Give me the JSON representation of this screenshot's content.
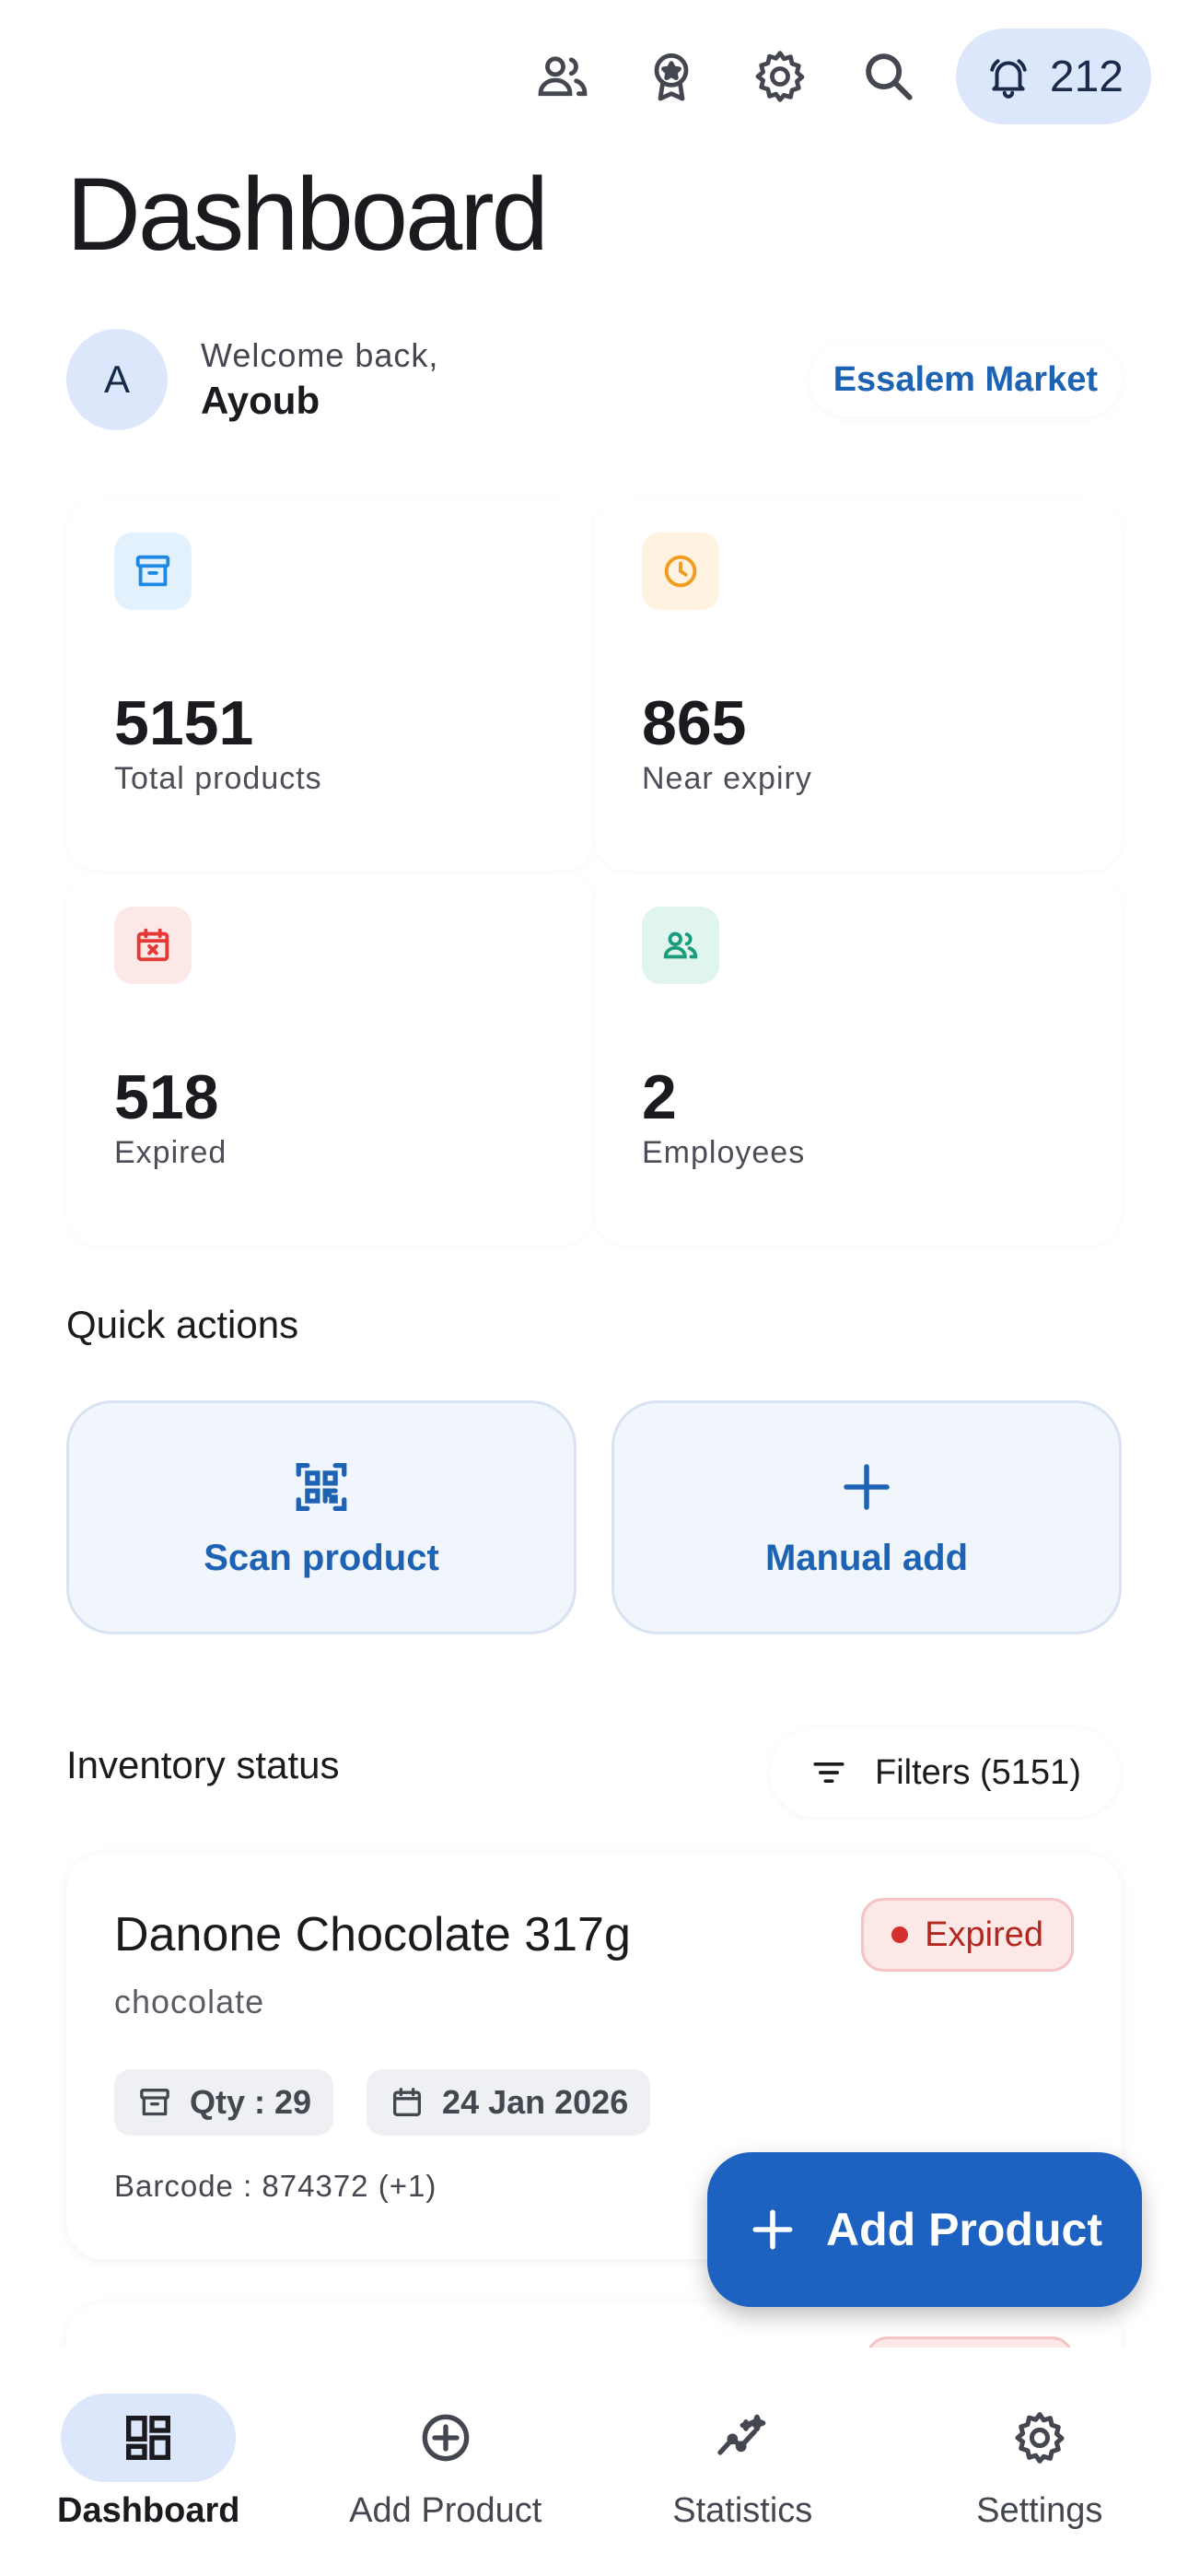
{
  "header": {
    "notification_count": "212",
    "icons": [
      "people-icon",
      "award-icon",
      "settings-gear-icon",
      "search-icon",
      "bell-icon"
    ]
  },
  "page": {
    "title": "Dashboard"
  },
  "welcome": {
    "avatar_initial": "A",
    "greeting": "Welcome back,",
    "name": "Ayoub",
    "store_name": "Essalem Market"
  },
  "stats": [
    {
      "value": "5151",
      "label": "Total products",
      "icon": "archive-box-icon",
      "color": "#1e88e5",
      "bg": "#e3f1fd"
    },
    {
      "value": "865",
      "label": "Near expiry",
      "icon": "clock-icon",
      "color": "#f29c1f",
      "bg": "#fff2e0"
    },
    {
      "value": "518",
      "label": "Expired",
      "icon": "calendar-x-icon",
      "color": "#e53935",
      "bg": "#fde8e8"
    },
    {
      "value": "2",
      "label": "Employees",
      "icon": "people-icon",
      "color": "#1a9c7c",
      "bg": "#e1f5ef"
    }
  ],
  "quick_actions": {
    "title": "Quick actions",
    "scan_label": "Scan product",
    "manual_label": "Manual add"
  },
  "inventory": {
    "title": "Inventory status",
    "filters_label": "Filters (5151)",
    "product": {
      "name": "Danone Chocolate 317g",
      "category": "chocolate",
      "status": "Expired",
      "qty": "Qty : 29",
      "date": "24 Jan 2026",
      "barcode": "Barcode : 874372 (+1)"
    }
  },
  "fab": {
    "label": "Add Product"
  },
  "bottom_nav": {
    "items": [
      {
        "label": "Dashboard",
        "icon": "dashboard-grid-icon",
        "active": true
      },
      {
        "label": "Add Product",
        "icon": "add-circle-icon",
        "active": false
      },
      {
        "label": "Statistics",
        "icon": "statistics-sparkle-icon",
        "active": false
      },
      {
        "label": "Settings",
        "icon": "settings-gear-icon",
        "active": false
      }
    ]
  },
  "colors": {
    "accent": "#1d62c0",
    "accent_text": "#1d62b3",
    "accent_light": "#dce7fb",
    "danger": "#b3261e"
  }
}
